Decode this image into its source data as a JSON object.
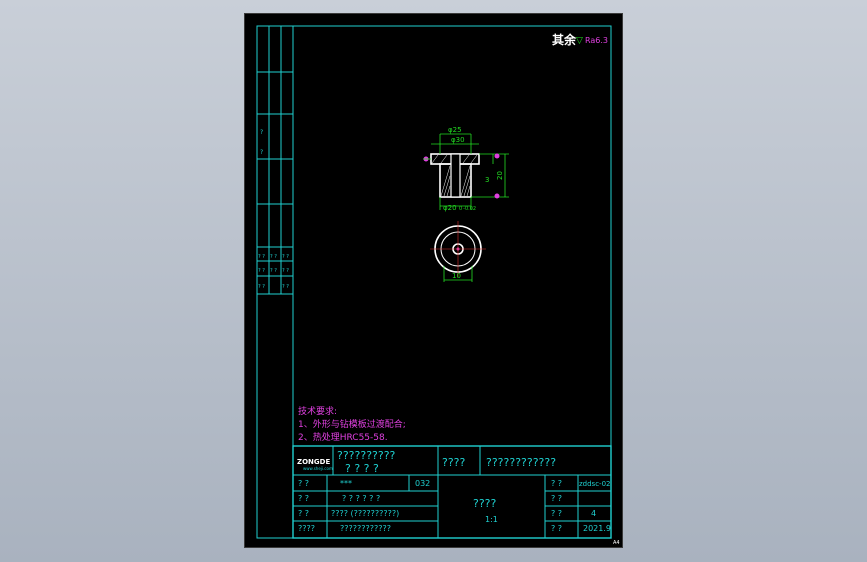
{
  "roughness": {
    "label": "其余",
    "symbol": "▽",
    "value": "Ra6.3"
  },
  "dimensions": {
    "outer_diameter": "φ25",
    "flange_diameter": "φ30",
    "bore": "φ20",
    "bore_tolerance": "0 -0.02",
    "height_1": "3",
    "height_2": "20",
    "thickness": "10"
  },
  "left_strip": {
    "marks": [
      "?",
      "?",
      "?",
      "?",
      "?",
      "?",
      "? ?",
      "? ?",
      "? ?",
      "? ?",
      "? ?",
      "? ?",
      "? ?",
      "? ?"
    ]
  },
  "tech_requirements": {
    "title": "技术要求:",
    "line1": "1、外形与钻模板过渡配合;",
    "line2": "2、热处理HRC55-58."
  },
  "title_block": {
    "logo_text": "ZONGDE",
    "logo_sub": "www.sheji.com",
    "school_line1": "??????????",
    "school_line2": "? ? ? ?",
    "part_label": "????",
    "part_name": "????????????",
    "row1_left": "?   ?",
    "row1_mid": "***",
    "row1_num": "032",
    "row2_left": "?   ?",
    "row2_mid": "? ? ? ? ? ?",
    "row3_left": "?   ?",
    "row3_mid": "????  (??????????)",
    "row4_left": "????",
    "row4_mid": "????????????",
    "center_label": "????",
    "scale": "1:1",
    "r1_label": "? ?",
    "r1_value": "zddsc-02",
    "r2_label": "? ?",
    "r2_value": "",
    "r3_label": "? ?",
    "r3_value": "4",
    "r4_label": "? ?",
    "r4_value": "2021.9"
  },
  "corner_mark": "A4"
}
